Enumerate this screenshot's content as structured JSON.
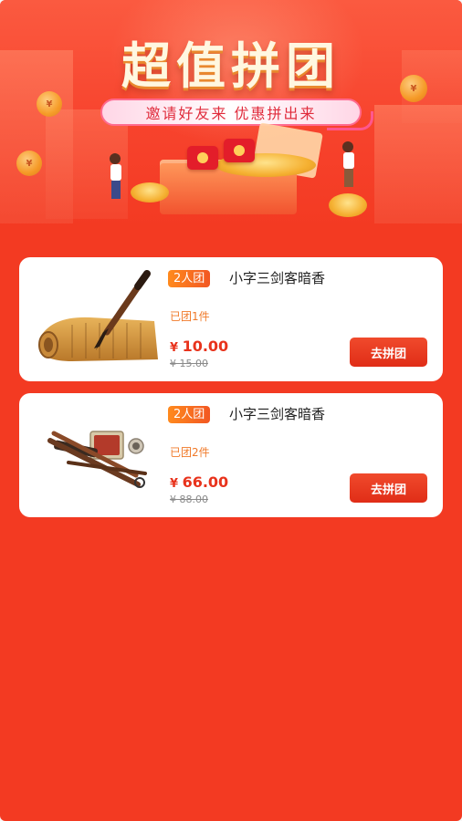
{
  "banner": {
    "title": "超值拼团",
    "slogan": "邀请好友来 优惠拼出来",
    "coin_symbol": "¥",
    "colors": {
      "background": "#f33a22",
      "title": "#fff7e0",
      "slogan_text": "#e02c3c"
    }
  },
  "products": [
    {
      "badge": "2人团",
      "name": "小字三剑客暗香",
      "joined": "已团1件",
      "currency": "¥",
      "price": "10.00",
      "original_price": "¥ 15.00",
      "button": "去拼团",
      "image_icon": "calligraphy-brush-scroll-icon"
    },
    {
      "badge": "2人团",
      "name": "小字三剑客暗香",
      "joined": "已团2件",
      "currency": "¥",
      "price": "66.00",
      "original_price": "¥ 88.00",
      "button": "去拼团",
      "image_icon": "brush-set-with-seal-icon"
    }
  ]
}
